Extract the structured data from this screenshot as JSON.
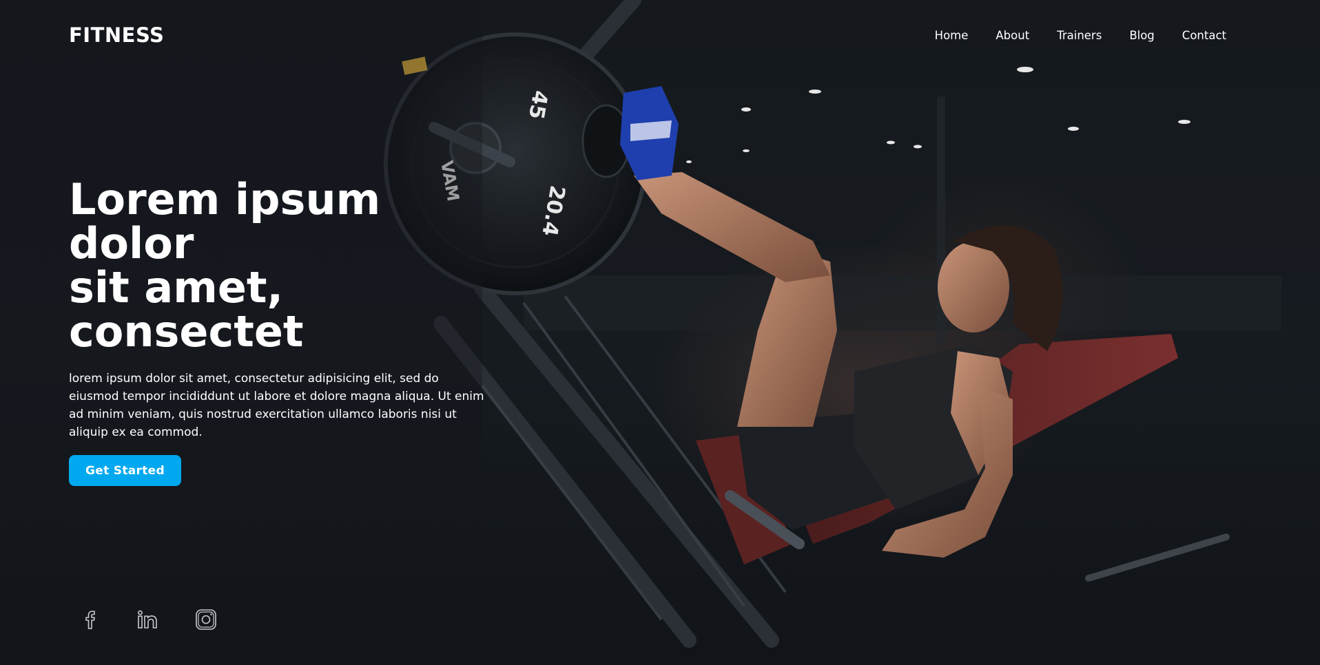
{
  "brand": {
    "logo": "FITNESS"
  },
  "nav": {
    "items": [
      {
        "label": "Home"
      },
      {
        "label": "About"
      },
      {
        "label": "Trainers"
      },
      {
        "label": "Blog"
      },
      {
        "label": "Contact"
      }
    ]
  },
  "hero": {
    "headline_lines": [
      "Lorem ipsum",
      "dolor",
      "sit amet,",
      "consectet"
    ],
    "description": "lorem ipsum dolor sit amet, consectetur adipisicing elit, sed do eiusmod tempor incididdunt ut labore et dolore magna aliqua. Ut enim ad minim veniam, quis nostrud exercitation ullamco laboris nisi ut aliquip ex ea commod.",
    "cta_label": "Get Started",
    "plate_labels": [
      "45",
      "20.4",
      "VAM"
    ]
  },
  "social": [
    {
      "icon": "facebook-icon"
    },
    {
      "icon": "linkedin-icon"
    },
    {
      "icon": "instagram-icon"
    }
  ],
  "colors": {
    "background": "#14181d",
    "accent": "#00a8ef",
    "text": "#ffffff"
  }
}
